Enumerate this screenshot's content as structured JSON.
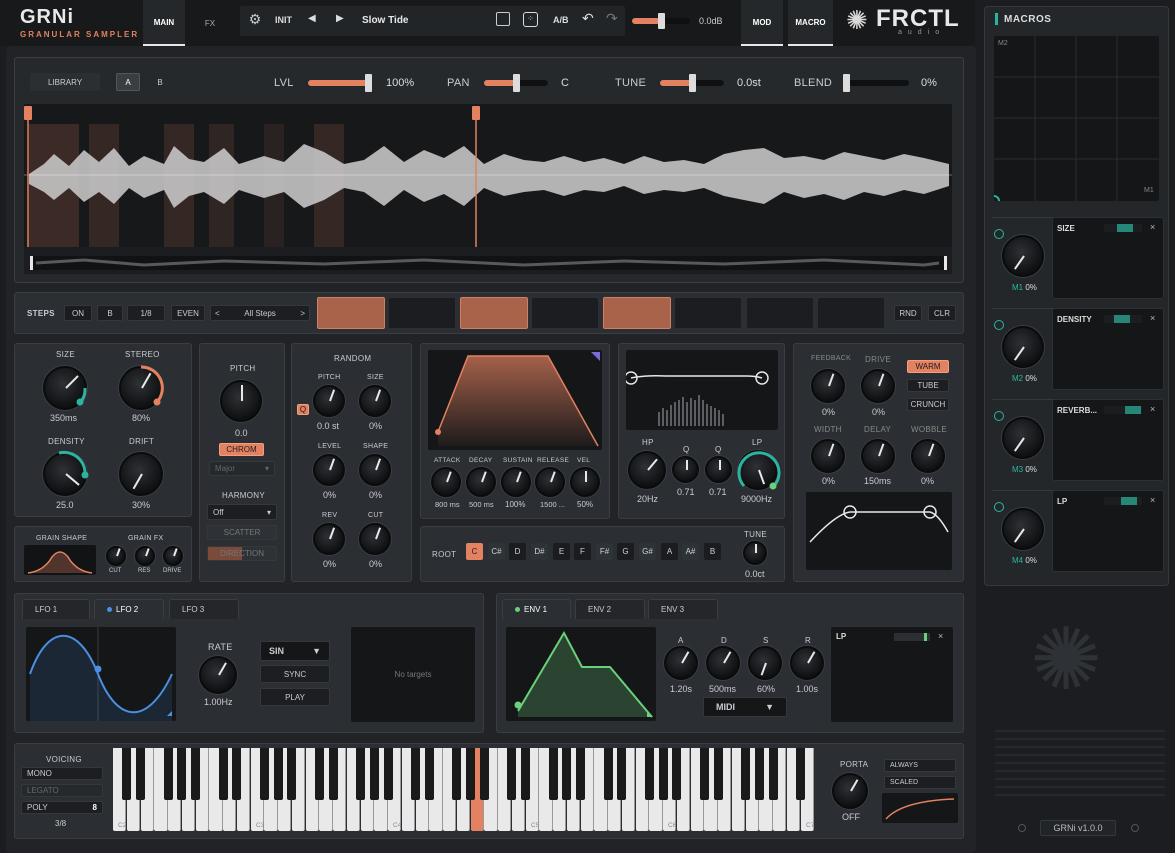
{
  "header": {
    "logo": "GRNi",
    "subtitle": "GRANULAR SAMPLER",
    "tabs": [
      "MAIN",
      "FX"
    ],
    "preset_init": "INIT",
    "preset_name": "Slow Tide",
    "ab": "A/B",
    "volume": "0.0dB",
    "right_tabs": [
      "MOD",
      "MACRO"
    ],
    "brand": "FRCTL",
    "brand_sub": "audio"
  },
  "sampler": {
    "library": "LIBRARY",
    "a": "A",
    "b": "B",
    "lvl_label": "LVL",
    "lvl_val": "100%",
    "lvl": 1.0,
    "pan_label": "PAN",
    "pan_val": "C",
    "pan": 0.5,
    "tune_label": "TUNE",
    "tune_val": "0.0st",
    "tune": 0.5,
    "blend_label": "BLEND",
    "blend_val": "0%",
    "blend": 0.0
  },
  "steps": {
    "label": "STEPS",
    "on": "ON",
    "b": "B",
    "rate": "1/8",
    "even": "EVEN",
    "prev": "<",
    "pattern": "All Steps",
    "next": ">",
    "pattern_on": [
      1,
      0,
      1,
      0,
      1,
      0,
      0,
      0
    ],
    "rnd": "RND",
    "clr": "CLR"
  },
  "grain": {
    "size_label": "SIZE",
    "size_val": "350ms",
    "stereo_label": "STEREO",
    "stereo_val": "80%",
    "density_label": "DENSITY",
    "density_val": "25.0",
    "drift_label": "DRIFT",
    "drift_val": "30%",
    "shape_label": "GRAIN SHAPE",
    "fx_label": "GRAIN FX",
    "cut": "CUT",
    "res": "RES",
    "drive": "DRIVE"
  },
  "pitch": {
    "label": "PITCH",
    "val": "0.0",
    "chrom": "CHROM",
    "scale": "Major",
    "harmony_label": "HARMONY",
    "harmony": "Off",
    "scatter": "SCATTER",
    "direction": "DIRECTION"
  },
  "random": {
    "label": "RANDOM",
    "q": "Q",
    "pitch_label": "PITCH",
    "pitch_val": "0.0 st",
    "size_label": "SIZE",
    "size_val": "0%",
    "level_label": "LEVEL",
    "level_val": "0%",
    "shape_label": "SHAPE",
    "shape_val": "0%",
    "rev_label": "REV",
    "rev_val": "0%",
    "cut_label": "CUT",
    "cut_val": "0%"
  },
  "env": {
    "attack_label": "ATTACK",
    "attack": "800 ms",
    "decay_label": "DECAY",
    "decay": "500 ms",
    "sustain_label": "SUSTAIN",
    "sustain": "100%",
    "release_label": "RELEASE",
    "release": "1500 ...",
    "vel_label": "VEL",
    "vel": "50%"
  },
  "root": {
    "label": "ROOT",
    "notes": [
      "C",
      "C#",
      "D",
      "D#",
      "E",
      "F",
      "F#",
      "G",
      "G#",
      "A",
      "A#",
      "B"
    ],
    "tune_label": "TUNE",
    "tune_val": "0.0ct"
  },
  "filter": {
    "hp_label": "HP",
    "hp_val": "20Hz",
    "q1_label": "Q",
    "q1_val": "0.71",
    "q2_label": "Q",
    "q2_val": "0.71",
    "lp_label": "LP",
    "lp_val": "9000Hz"
  },
  "fx": {
    "feedback_label": "FEEDBACK",
    "feedback": "0%",
    "drive_label": "DRIVE",
    "drive": "0%",
    "warm": "WARM",
    "tube": "TUBE",
    "crunch": "CRUNCH",
    "width_label": "WIDTH",
    "width": "0%",
    "delay_label": "DELAY",
    "delay": "150ms",
    "wobble_label": "WOBBLE",
    "wobble": "0%"
  },
  "lfo": {
    "tabs": [
      "LFO 1",
      "LFO 2",
      "LFO 3"
    ],
    "rate_label": "RATE",
    "rate_val": "1.00Hz",
    "wave": "SIN",
    "sync": "SYNC",
    "play": "PLAY",
    "targets": "No targets"
  },
  "envmod": {
    "tabs": [
      "ENV 1",
      "ENV 2",
      "ENV 3"
    ],
    "a_label": "A",
    "a": "1.20s",
    "d_label": "D",
    "d": "500ms",
    "s_label": "S",
    "s": "60%",
    "r_label": "R",
    "r": "1.00s",
    "midi": "MIDI",
    "target": "LP"
  },
  "voicing": {
    "label": "VOICING",
    "mono": "MONO",
    "legato": "LEGATO",
    "poly": "POLY",
    "poly_val": "8",
    "count": "3/8"
  },
  "keyboard": {
    "c2": "C2",
    "c3": "C3",
    "c4": "C4",
    "c5": "C5",
    "c6": "C6",
    "c7": "C7"
  },
  "porta": {
    "label": "PORTA",
    "val": "OFF",
    "always": "ALWAYS",
    "scaled": "SCALED"
  },
  "macros": {
    "title": "MACROS",
    "xy_y": "M2",
    "xy_x": "M1",
    "items": [
      {
        "name": "SIZE",
        "knob": "M1",
        "val": "0%"
      },
      {
        "name": "DENSITY",
        "knob": "M2",
        "val": "0%"
      },
      {
        "name": "REVERB...",
        "knob": "M3",
        "val": "0%"
      },
      {
        "name": "LP",
        "knob": "M4",
        "val": "0%"
      }
    ]
  },
  "footer": {
    "version": "GRNi v1.0.0"
  },
  "colors": {
    "accent": "#e38160",
    "teal": "#2bb5a0",
    "blue": "#4a8fe0",
    "green": "#6ad07a"
  }
}
